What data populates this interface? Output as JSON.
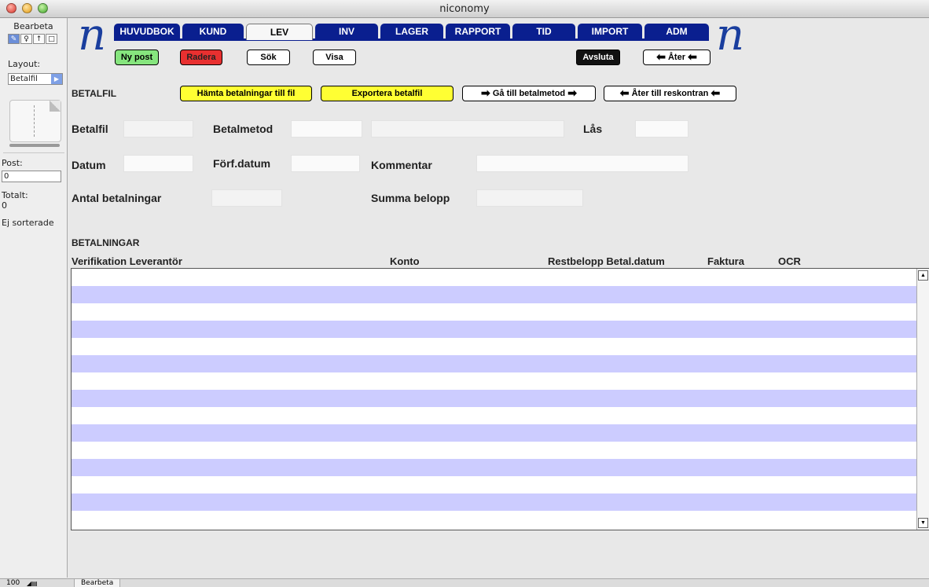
{
  "window": {
    "title": "niconomy"
  },
  "sidebar": {
    "mode": "Bearbeta",
    "layout_label": "Layout:",
    "layout_value": "Betalfil",
    "post_label": "Post:",
    "post_value": "0",
    "total_label": "Totalt:",
    "total_value": "0",
    "sort_status": "Ej sorterade"
  },
  "bottom_bar": {
    "zoom": "100",
    "mode": "Bearbeta"
  },
  "tabs": [
    "HUVUDBOK",
    "KUND",
    "LEV",
    "INV",
    "LAGER",
    "RAPPORT",
    "TID",
    "IMPORT",
    "ADM"
  ],
  "active_tab": "LEV",
  "toolbar": {
    "new_post": "Ny post",
    "delete": "Radera",
    "search": "Sök",
    "show": "Visa",
    "quit": "Avsluta",
    "back": "Åter"
  },
  "section": {
    "title": "BETALFIL",
    "fetch_payments": "Hämta betalningar till fil",
    "export_file": "Exportera betalfil",
    "goto_method": "Gå till betalmetod",
    "back_to_ledger": "Åter till reskontran"
  },
  "form": {
    "betalfil_label": "Betalfil",
    "betalfil_value": "",
    "betalmetod_label": "Betalmetod",
    "betalmetod_value": "",
    "betalmetod_name": "",
    "las_label": "Lås",
    "las_value": "",
    "datum_label": "Datum",
    "datum_value": "",
    "forfdatum_label": "Förf.datum",
    "forfdatum_value": "",
    "kommentar_label": "Kommentar",
    "kommentar_value": "",
    "antal_label": "Antal betalningar",
    "antal_value": "",
    "summa_label": "Summa belopp",
    "summa_value": ""
  },
  "payments": {
    "title": "BETALNINGAR",
    "columns": [
      "Verifikation Leverantör",
      "Konto",
      "Restbelopp Betal.datum",
      "Faktura",
      "OCR"
    ],
    "rows": []
  },
  "colors": {
    "tab_bg": "#0a1f8f",
    "row_alt": "#ccccff",
    "button_yellow": "#ffff33",
    "button_green": "#86e57e",
    "button_red": "#e83030"
  }
}
